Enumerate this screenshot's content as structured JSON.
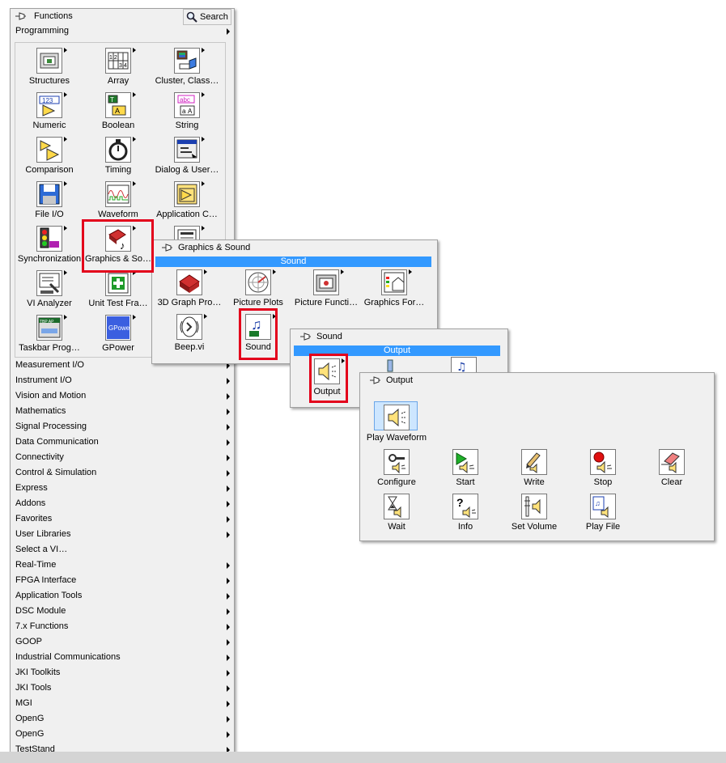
{
  "functions_palette": {
    "title": "Functions",
    "search_label": "Search",
    "programming_label": "Programming",
    "programming_items": [
      {
        "label": "Structures",
        "icon": "structures-icon"
      },
      {
        "label": "Array",
        "icon": "array-icon"
      },
      {
        "label": "Cluster, Class…",
        "icon": "cluster-icon"
      },
      {
        "label": "Numeric",
        "icon": "numeric-icon"
      },
      {
        "label": "Boolean",
        "icon": "boolean-icon"
      },
      {
        "label": "String",
        "icon": "string-icon"
      },
      {
        "label": "Comparison",
        "icon": "comparison-icon"
      },
      {
        "label": "Timing",
        "icon": "stopwatch-icon"
      },
      {
        "label": "Dialog & User…",
        "icon": "dialog-icon"
      },
      {
        "label": "File I/O",
        "icon": "floppy-disk-icon"
      },
      {
        "label": "Waveform",
        "icon": "waveform-icon"
      },
      {
        "label": "Application C…",
        "icon": "application-control-icon"
      },
      {
        "label": "Synchronization",
        "icon": "traffic-light-icon"
      },
      {
        "label": "Graphics & So…",
        "icon": "graphics-sound-icon"
      },
      {
        "label": "",
        "icon": "report-icon"
      },
      {
        "label": "VI Analyzer",
        "icon": "microscope-icon"
      },
      {
        "label": "Unit Test Fra…",
        "icon": "unit-test-icon"
      },
      {
        "label": "",
        "icon": ""
      },
      {
        "label": "Taskbar Prog…",
        "icon": "taskbar-icon"
      },
      {
        "label": "GPower",
        "icon": "gpower-icon"
      }
    ],
    "categories": [
      "Measurement I/O",
      "Instrument I/O",
      "Vision and Motion",
      "Mathematics",
      "Signal Processing",
      "Data Communication",
      "Connectivity",
      "Control & Simulation",
      "Express",
      "Addons",
      "Favorites",
      "User Libraries",
      "Select a VI…",
      "Real-Time",
      "FPGA Interface",
      "Application Tools",
      "DSC Module",
      "7.x Functions",
      "GOOP",
      "Industrial Communications",
      "JKI Toolkits",
      "JKI Tools",
      "MGI",
      "OpenG",
      "OpenG",
      "TestStand"
    ],
    "categories_without_arrow": [
      "Select a VI…"
    ]
  },
  "graphics_sound_palette": {
    "title": "Graphics & Sound",
    "header": "Sound",
    "items": [
      {
        "label": "3D Graph Pro…",
        "icon": "3d-graph-icon"
      },
      {
        "label": "Picture Plots",
        "icon": "polar-plot-icon"
      },
      {
        "label": "Picture Functi…",
        "icon": "picture-icon"
      },
      {
        "label": "Graphics For…",
        "icon": "graphics-format-icon"
      },
      {
        "label": "Beep.vi",
        "icon": "beep-icon"
      },
      {
        "label": "Sound",
        "icon": "music-notes-icon"
      }
    ]
  },
  "sound_palette": {
    "title": "Sound",
    "header": "Output",
    "items": [
      {
        "label": "Output",
        "icon": "speaker-icon"
      }
    ]
  },
  "output_palette": {
    "title": "Output",
    "items": [
      {
        "label": "Play Waveform",
        "icon": "speaker-icon"
      },
      {
        "label": "Configure",
        "icon": "configure-icon"
      },
      {
        "label": "Start",
        "icon": "play-icon"
      },
      {
        "label": "Write",
        "icon": "pencil-icon"
      },
      {
        "label": "Stop",
        "icon": "stop-icon"
      },
      {
        "label": "Clear",
        "icon": "eraser-icon"
      },
      {
        "label": "Wait",
        "icon": "hourglass-icon"
      },
      {
        "label": "Info",
        "icon": "info-icon"
      },
      {
        "label": "Set Volume",
        "icon": "volume-icon"
      },
      {
        "label": "Play File",
        "icon": "play-file-icon"
      }
    ]
  },
  "colors": {
    "highlight": "#e3001b",
    "accent": "#3399ff",
    "panel": "#f0f0f0"
  }
}
